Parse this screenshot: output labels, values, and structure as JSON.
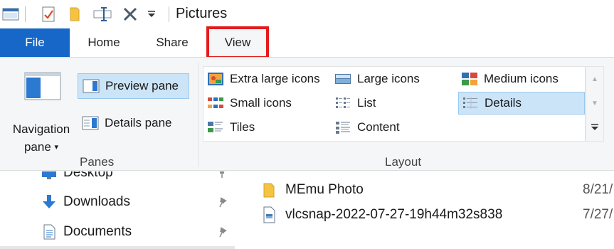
{
  "window": {
    "title": "Pictures"
  },
  "quick_access": {
    "icons": [
      "app-icon",
      "properties-icon",
      "new-folder-icon",
      "rename-icon",
      "delete-icon",
      "customize-dropdown-icon"
    ]
  },
  "tabs": {
    "file": "File",
    "home": "Home",
    "share": "Share",
    "view": "View",
    "highlight_color": "#e41b1b",
    "file_color": "#1667c7"
  },
  "panes_group": {
    "navigation_pane_line1": "Navigation",
    "navigation_pane_line2": "pane",
    "navigation_pane_caret": "▾",
    "preview_pane": "Preview pane",
    "details_pane": "Details pane",
    "label": "Panes"
  },
  "layout_group": {
    "label": "Layout",
    "items": {
      "extra_large_icons": "Extra large icons",
      "large_icons": "Large icons",
      "medium_icons": "Medium icons",
      "small_icons": "Small icons",
      "list": "List",
      "details": "Details",
      "tiles": "Tiles",
      "content": "Content"
    },
    "selected": "Details",
    "selected_color": "#cce4f7"
  },
  "nav_items": {
    "desktop": "Desktop",
    "downloads": "Downloads",
    "documents": "Documents"
  },
  "files": [
    {
      "name": "MEmu Photo",
      "date": "8/21/",
      "type": "folder"
    },
    {
      "name": "vlcsnap-2022-07-27-19h44m32s838",
      "date": "7/27/",
      "type": "image"
    }
  ]
}
